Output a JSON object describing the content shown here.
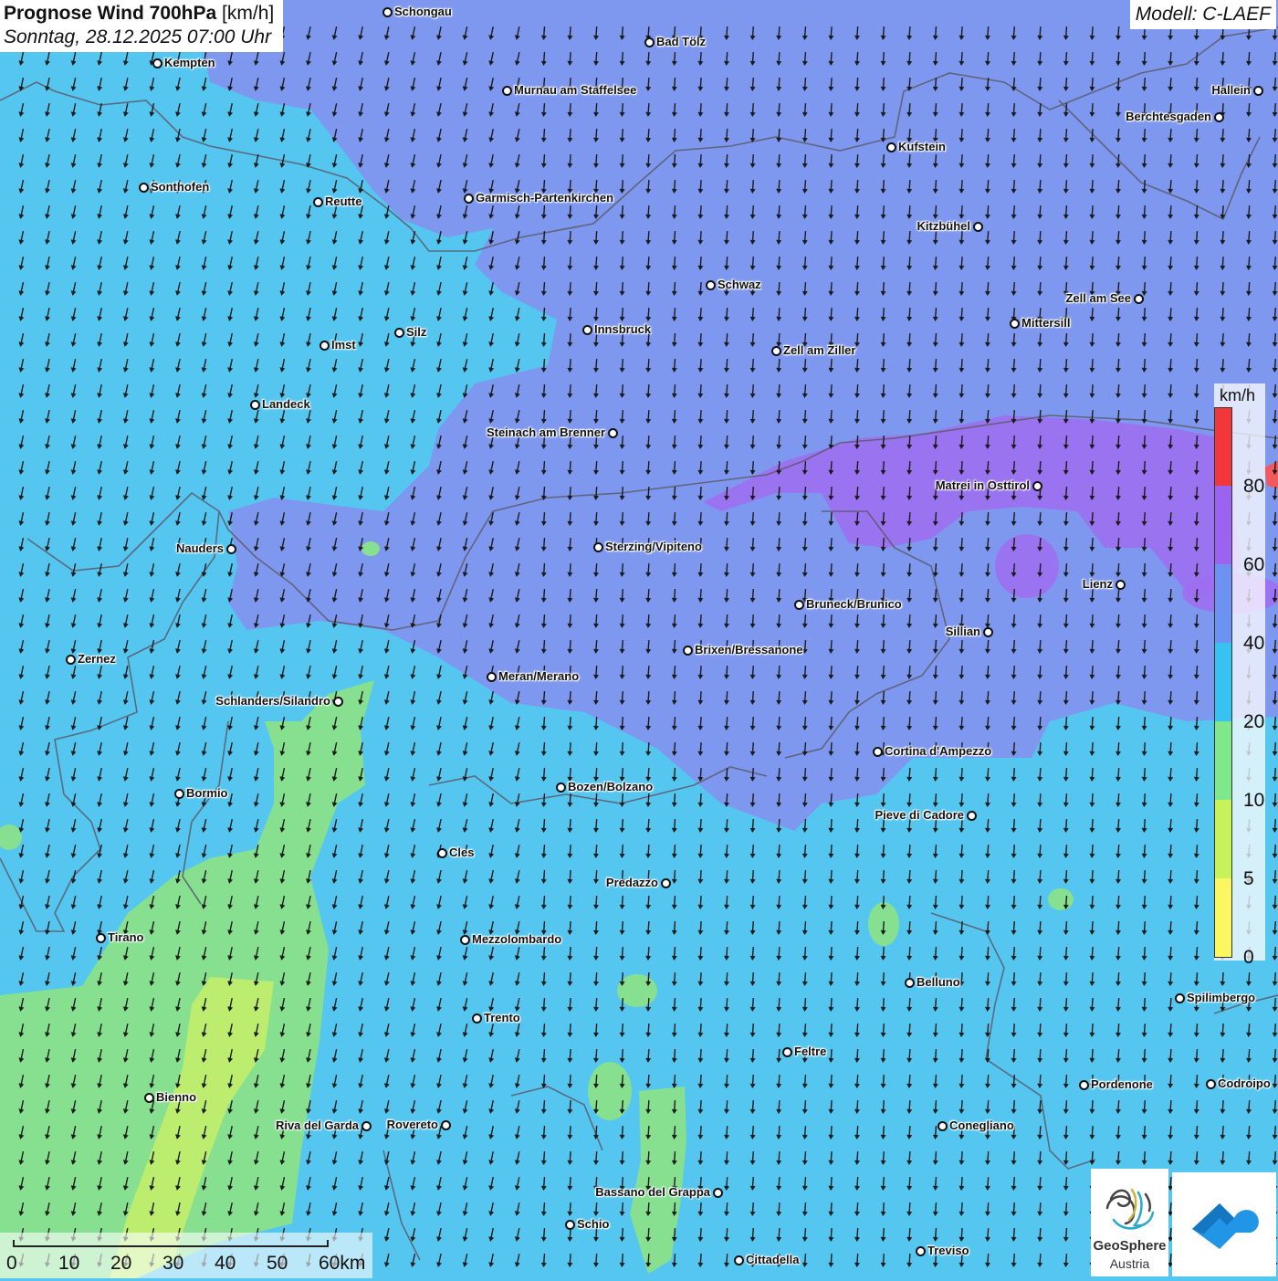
{
  "title": {
    "main": "Prognose Wind 700hPa",
    "unit": "[km/h]",
    "datetime": "Sonntag, 28.12.2025 07:00 Uhr"
  },
  "model": "Modell: C-LAEF",
  "legend": {
    "unit": "km/h",
    "ticks": [
      "80",
      "60",
      "40",
      "20",
      "10",
      "5",
      "0"
    ],
    "colors": [
      "#f2373a",
      "#9b64f0",
      "#6d93f2",
      "#37c2f2",
      "#7ee88b",
      "#c8f25a",
      "#fcf660"
    ]
  },
  "scale": {
    "labels": [
      "0",
      "10",
      "20",
      "30",
      "40",
      "50",
      "60km"
    ]
  },
  "logo": {
    "line1": "GeoSphere",
    "line2": "Austria"
  },
  "cities": [
    {
      "name": "Schongau"
    },
    {
      "name": "Bad Tölz"
    },
    {
      "name": "Kempten"
    },
    {
      "name": "Murnau am Staffelsee"
    },
    {
      "name": "Hallein"
    },
    {
      "name": "Berchtesgaden"
    },
    {
      "name": "Kufstein"
    },
    {
      "name": "Sonthofen"
    },
    {
      "name": "Reutte"
    },
    {
      "name": "Garmisch-Partenkirchen"
    },
    {
      "name": "Kitzbühel"
    },
    {
      "name": "Schwaz"
    },
    {
      "name": "Zell am See"
    },
    {
      "name": "Mittersill"
    },
    {
      "name": "Innsbruck"
    },
    {
      "name": "Silz"
    },
    {
      "name": "Imst"
    },
    {
      "name": "Zell am Ziller"
    },
    {
      "name": "Landeck"
    },
    {
      "name": "Steinach am Brenner"
    },
    {
      "name": "Matrei in Osttirol"
    },
    {
      "name": "Nauders"
    },
    {
      "name": "Sterzing/Vipiteno"
    },
    {
      "name": "Lienz"
    },
    {
      "name": "Bruneck/Brunico"
    },
    {
      "name": "Sillian"
    },
    {
      "name": "Zernez"
    },
    {
      "name": "Brixen/Bressanone"
    },
    {
      "name": "Meran/Merano"
    },
    {
      "name": "Schlanders/Silandro"
    },
    {
      "name": "Cortina d'Ampezzo"
    },
    {
      "name": "Bozen/Bolzano"
    },
    {
      "name": "Bormio"
    },
    {
      "name": "Pieve di Cadore"
    },
    {
      "name": "Cles"
    },
    {
      "name": "Predazzo"
    },
    {
      "name": "Tirano"
    },
    {
      "name": "Mezzolombardo"
    },
    {
      "name": "Belluno"
    },
    {
      "name": "Spilimbergo"
    },
    {
      "name": "Trento"
    },
    {
      "name": "Feltre"
    },
    {
      "name": "Pordenone"
    },
    {
      "name": "Codroipo"
    },
    {
      "name": "Bienno"
    },
    {
      "name": "Riva del Garda"
    },
    {
      "name": "Rovereto"
    },
    {
      "name": "Conegliano"
    },
    {
      "name": "Bassano del Grappa"
    },
    {
      "name": "Schio"
    },
    {
      "name": "Treviso"
    },
    {
      "name": "Cittadella"
    }
  ]
}
